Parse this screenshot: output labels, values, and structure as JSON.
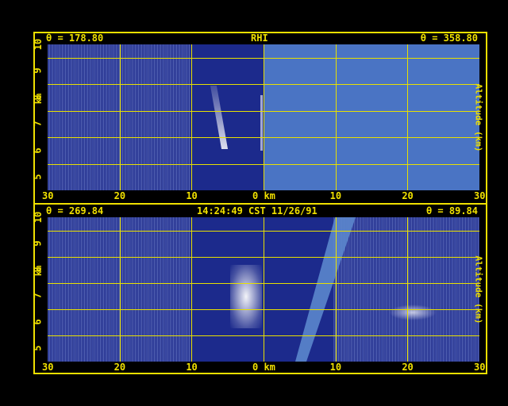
{
  "top_header": {
    "left": "θ = 178.80",
    "center": "RHI",
    "right": "θ = 358.80"
  },
  "bottom_header": {
    "left": "θ = 269.84",
    "center": "14:24:49 CST 11/26/91",
    "right": "θ = 89.84"
  },
  "x_ticks": [
    "30",
    "20",
    "10",
    "0 km",
    "10",
    "20",
    "30"
  ],
  "y_ticks": [
    "5",
    "6",
    "7",
    "8",
    "9",
    "10"
  ],
  "y_label_left": "km",
  "y_label_right": "Altitude (km)",
  "colors": {
    "frame": "#f0e000",
    "panel_background": "#1c2a8c",
    "blocked_sector": "#4a74c4"
  }
}
